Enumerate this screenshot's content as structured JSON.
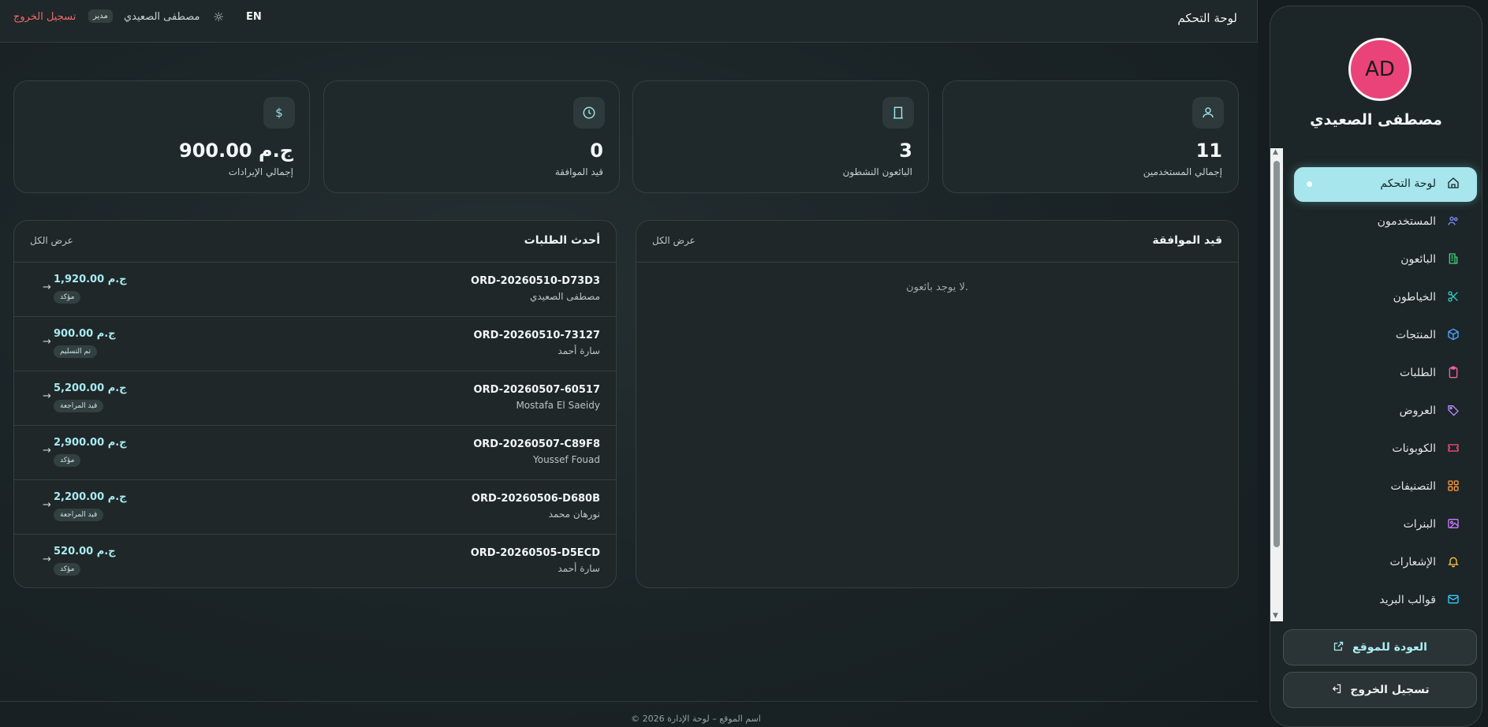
{
  "header": {
    "title": "لوحة التحكم",
    "lang": "EN",
    "user_name": "مصطفى الصعيدي",
    "role": "مدير",
    "logout": "تسجيل الخروج"
  },
  "stats": [
    {
      "label": "إجمالي المستخدمين",
      "value": "11",
      "icon": "users-icon"
    },
    {
      "label": "البائعون النشطون",
      "value": "3",
      "icon": "store-icon"
    },
    {
      "label": "قيد الموافقة",
      "value": "0",
      "icon": "clock-icon"
    },
    {
      "label": "إجمالي الإيرادات",
      "value": "900.00 ج.م",
      "icon": "money-icon"
    }
  ],
  "pending": {
    "title": "قيد الموافقة",
    "view_all": "عرض الكل",
    "empty": "لا يوجد بائعون."
  },
  "orders": {
    "title": "أحدث الطلبات",
    "view_all": "عرض الكل",
    "rows": [
      {
        "id": "ORD-20260510-D73D3",
        "customer": "مصطفى الصعيدي",
        "amount": "1,920.00 ج.م",
        "status": "مؤكد"
      },
      {
        "id": "ORD-20260510-73127",
        "customer": "سارة أحمد",
        "amount": "900.00 ج.م",
        "status": "تم التسليم"
      },
      {
        "id": "ORD-20260507-60517",
        "customer": "Mostafa El Saeidy",
        "amount": "5,200.00 ج.م",
        "status": "قيد المراجعة"
      },
      {
        "id": "ORD-20260507-C89F8",
        "customer": "Youssef Fouad",
        "amount": "2,900.00 ج.م",
        "status": "مؤكد"
      },
      {
        "id": "ORD-20260506-D680B",
        "customer": "نورهان محمد",
        "amount": "2,200.00 ج.م",
        "status": "قيد المراجعة"
      },
      {
        "id": "ORD-20260505-D5ECD",
        "customer": "سارة أحمد",
        "amount": "520.00 ج.م",
        "status": "مؤكد"
      }
    ]
  },
  "footer": "© 2026 اسم الموقع – لوحة الإدارة",
  "sidebar": {
    "initials": "AD",
    "name": "مصطفى الصعيدي",
    "items": [
      {
        "label": "لوحة التحكم",
        "icon": "home-icon",
        "color": "#17282b"
      },
      {
        "label": "المستخدمون",
        "icon": "users-icon",
        "color": "#7f8cff"
      },
      {
        "label": "البائعون",
        "icon": "building-icon",
        "color": "#3fd27a"
      },
      {
        "label": "الخياطون",
        "icon": "scissors-icon",
        "color": "#2fd6c6"
      },
      {
        "label": "المنتجات",
        "icon": "box-icon",
        "color": "#4da8ff"
      },
      {
        "label": "الطلبات",
        "icon": "clipboard-icon",
        "color": "#ff5fa8"
      },
      {
        "label": "العروض",
        "icon": "tag-icon",
        "color": "#b98cff"
      },
      {
        "label": "الكوبونات",
        "icon": "ticket-icon",
        "color": "#ff4f7a"
      },
      {
        "label": "التصنيفات",
        "icon": "grid-icon",
        "color": "#ff9a3c"
      },
      {
        "label": "البنرات",
        "icon": "image-icon",
        "color": "#c77dff"
      },
      {
        "label": "الإشعارات",
        "icon": "bell-icon",
        "color": "#ffc83c"
      },
      {
        "label": "قوالب البريد",
        "icon": "mail-icon",
        "color": "#3cc8ff"
      }
    ],
    "back_site": "العودة للموقع",
    "logout": "تسجيل الخروج"
  }
}
